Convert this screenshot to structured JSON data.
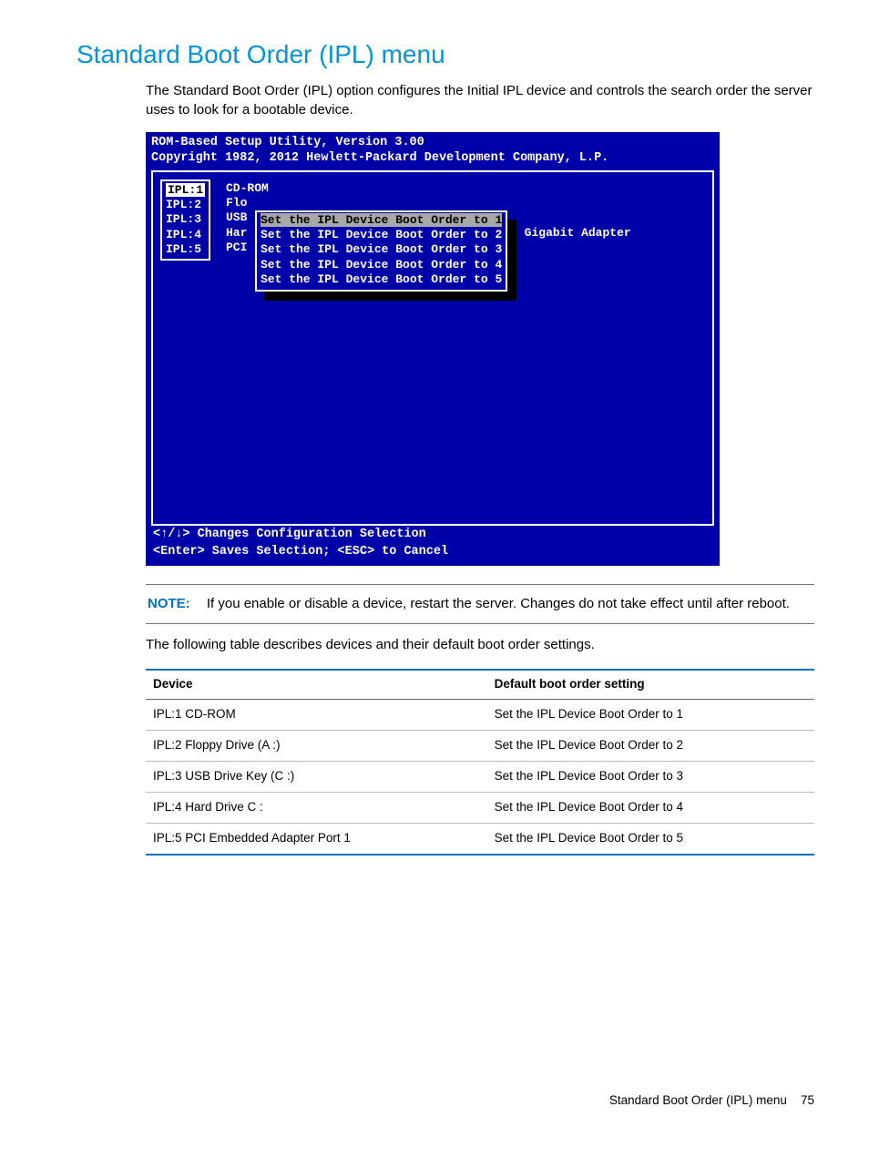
{
  "heading": "Standard Boot Order (IPL) menu",
  "intro": "The Standard Boot Order (IPL) option configures the Initial IPL device and controls the search order the server uses to look for a bootable device.",
  "bios": {
    "title_line": "ROM-Based Setup Utility, Version 3.00",
    "copyright_line": "Copyright 1982, 2012 Hewlett-Packard Development Company, L.P.",
    "ipl_labels": [
      "IPL:1",
      "IPL:2",
      "IPL:3",
      "IPL:4",
      "IPL:5"
    ],
    "ipl_devices": [
      "CD-ROM",
      "Flo",
      "USB",
      "Har",
      "PCI"
    ],
    "device_tail": "rt Gigabit Adapter",
    "submenu": [
      "Set the IPL Device Boot Order to 1",
      "Set the IPL Device Boot Order to 2",
      "Set the IPL Device Boot Order to 3",
      "Set the IPL Device Boot Order to 4",
      "Set the IPL Device Boot Order to 5"
    ],
    "help1": "<↑/↓> Changes Configuration Selection",
    "help2": "<Enter> Saves Selection; <ESC> to Cancel"
  },
  "note_label": "NOTE:",
  "note_text": "If you enable or disable a device, restart the server. Changes do not take effect until after reboot.",
  "table_intro": "The following table describes devices and their default boot order settings.",
  "table": {
    "headers": [
      "Device",
      "Default boot order setting"
    ],
    "rows": [
      [
        "IPL:1 CD-ROM",
        "Set the IPL Device Boot Order to 1"
      ],
      [
        "IPL:2 Floppy Drive (A :)",
        "Set the IPL Device Boot Order to 2"
      ],
      [
        "IPL:3 USB Drive Key (C :)",
        "Set the IPL Device Boot Order to 3"
      ],
      [
        "IPL:4 Hard Drive C :",
        "Set the IPL Device Boot Order to 4"
      ],
      [
        "IPL:5 PCI Embedded Adapter Port 1",
        "Set the IPL Device Boot Order to 5"
      ]
    ]
  },
  "footer_title": "Standard Boot Order (IPL) menu",
  "footer_page": "75"
}
